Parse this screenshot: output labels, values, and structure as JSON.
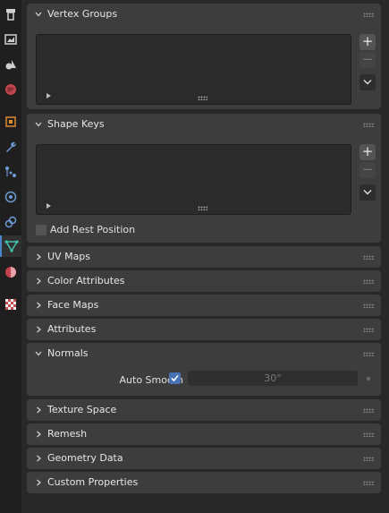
{
  "tabs": [
    {
      "icon": "tool-icon"
    },
    {
      "icon": "render-icon"
    },
    {
      "icon": "output-icon"
    },
    {
      "icon": "view-layer-icon"
    },
    {
      "icon": "scene-icon"
    },
    {
      "icon": "world-icon"
    },
    {
      "icon": "object-icon"
    },
    {
      "icon": "modifier-wrench-icon"
    },
    {
      "icon": "particles-icon"
    },
    {
      "icon": "physics-icon"
    },
    {
      "icon": "constraints-icon"
    },
    {
      "icon": "object-data-mesh-icon"
    },
    {
      "icon": "material-icon"
    },
    {
      "icon": "texture-icon"
    }
  ],
  "active_tab": "object-data-mesh-icon",
  "accent_color": "#4772b3",
  "data_icon_color": "#3fc1a8",
  "panels": {
    "vertex_groups": {
      "title": "Vertex Groups",
      "expanded": true
    },
    "shape_keys": {
      "title": "Shape Keys",
      "expanded": true,
      "add_rest_position_label": "Add Rest Position",
      "add_rest_position_checked": false
    },
    "uv_maps": {
      "title": "UV Maps",
      "expanded": false
    },
    "color_attributes": {
      "title": "Color Attributes",
      "expanded": false
    },
    "face_maps": {
      "title": "Face Maps",
      "expanded": false
    },
    "attributes": {
      "title": "Attributes",
      "expanded": false
    },
    "normals": {
      "title": "Normals",
      "expanded": true,
      "auto_smooth_label": "Auto Smooth",
      "auto_smooth_checked": true,
      "angle_value": "30°"
    },
    "texture_space": {
      "title": "Texture Space",
      "expanded": false
    },
    "remesh": {
      "title": "Remesh",
      "expanded": false
    },
    "geometry_data": {
      "title": "Geometry Data",
      "expanded": false
    },
    "custom_properties": {
      "title": "Custom Properties",
      "expanded": false
    }
  },
  "list_buttons": {
    "add": "+",
    "remove": "−"
  }
}
